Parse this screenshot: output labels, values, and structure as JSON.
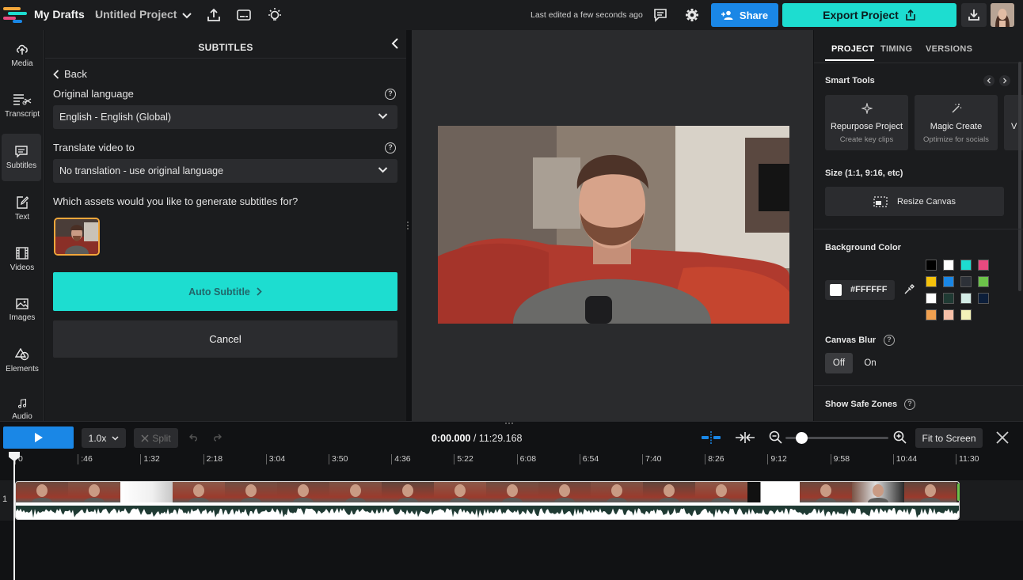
{
  "topbar": {
    "drafts_label": "My Drafts",
    "separator": "›",
    "project_name": "Untitled Project",
    "last_edited": "Last edited a few seconds ago",
    "share_label": "Share",
    "export_label": "Export Project"
  },
  "rail": {
    "items": [
      {
        "label": "Media",
        "icon": "media-icon"
      },
      {
        "label": "Transcript",
        "icon": "transcript-icon"
      },
      {
        "label": "Subtitles",
        "icon": "subtitles-icon"
      },
      {
        "label": "Text",
        "icon": "text-icon"
      },
      {
        "label": "Videos",
        "icon": "videos-icon"
      },
      {
        "label": "Images",
        "icon": "images-icon"
      },
      {
        "label": "Elements",
        "icon": "elements-icon"
      },
      {
        "label": "Audio",
        "icon": "audio-icon"
      }
    ]
  },
  "subtitles_panel": {
    "title": "SUBTITLES",
    "back_label": "Back",
    "original_language_label": "Original language",
    "original_language_value": "English - English (Global)",
    "translate_label": "Translate video to",
    "translate_value": "No translation - use original language",
    "assets_question": "Which assets would you like to generate subtitles for?",
    "auto_subtitle_label": "Auto Subtitle",
    "cancel_label": "Cancel"
  },
  "right_panel": {
    "tabs": [
      "PROJECT",
      "TIMING",
      "VERSIONS"
    ],
    "active_tab": "PROJECT",
    "smart_tools_label": "Smart Tools",
    "tools": [
      {
        "title": "Repurpose Project",
        "subtitle": "Create key clips",
        "icon": "sparkle-icon"
      },
      {
        "title": "Magic Create",
        "subtitle": "Optimize for socials",
        "icon": "magic-wand-icon"
      },
      {
        "title": "V",
        "subtitle": "",
        "icon": ""
      }
    ],
    "size_label": "Size (1:1, 9:16, etc)",
    "resize_label": "Resize Canvas",
    "bg_color_label": "Background Color",
    "bg_color_value": "#FFFFFF",
    "swatches": [
      "#000000",
      "#FFFFFF",
      "#1dddd0",
      "#e84a7f",
      "#f5c20b",
      "#1a87e6",
      "#2d3138",
      "#6cc24a",
      "#ffffff",
      "#1f3a33",
      "#d4ece6",
      "#0c1e3a",
      "#f0a050",
      "#f7c0a8",
      "#f3f2b8"
    ],
    "canvas_blur_label": "Canvas Blur",
    "blur_off": "Off",
    "blur_on": "On",
    "safe_zones_label": "Show Safe Zones"
  },
  "timeline": {
    "speed": "1.0x",
    "split_label": "Split",
    "current_time": "0:00.000",
    "total_time": "/ 11:29.168",
    "fit_label": "Fit to Screen",
    "zoom_level": 0.15,
    "track_number": "1",
    "ticks": [
      "0",
      ":46",
      "1:32",
      "2:18",
      "3:04",
      "3:50",
      "4:36",
      "5:22",
      "6:08",
      "6:54",
      "7:40",
      "8:26",
      "9:12",
      "9:58",
      "10:44",
      "11:30"
    ]
  },
  "colors": {
    "accent_teal": "#1dddd0",
    "accent_blue": "#1a87e6",
    "asset_border": "#f3a73b"
  }
}
